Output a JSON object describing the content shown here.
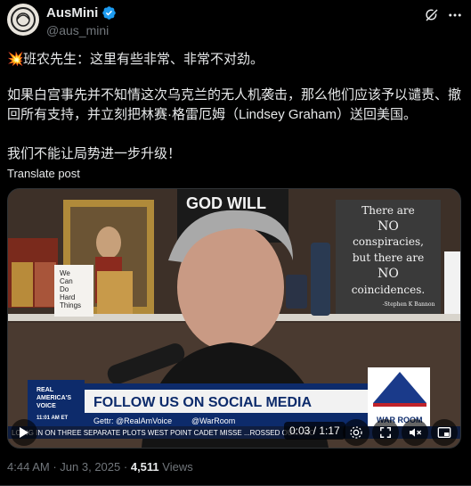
{
  "account": {
    "display_name": "AusMini",
    "handle": "@aus_mini"
  },
  "post": {
    "line1_emoji": "💥",
    "line1_text": "班农先生：这里有些非常、非常不对劲。",
    "paragraph2": "如果白宫事先并不知情这次乌克兰的无人机袭击，那么他们应该予以谴责、撤回所有支持，并立刻把林赛·格雷厄姆（Lindsey Graham）送回美国。",
    "paragraph3": "我们不能让局势进一步升级！",
    "translate_label": "Translate post"
  },
  "video": {
    "wall_sign": "GOD WILL",
    "sign_lines": [
      "There are",
      "NO",
      "conspiracies,",
      "but there are",
      "NO",
      "coincidences."
    ],
    "sign_credit": "-Stephen K Bannon",
    "small_sign": [
      "We",
      "Can",
      "Do",
      "Hard",
      "Things"
    ],
    "lower_third_title": "FOLLOW US ON SOCIAL MEDIA",
    "network_logo_line1": "REAL",
    "network_logo_line2": "AMERICA'S",
    "network_logo_line3": "VOICE",
    "clock": "11:01 AM ET",
    "gettr": "Gettr: @RealAmVoice",
    "warroom_handle": "@WarRoom",
    "warroom_logo": "WAR ROOM",
    "ticker": "LOING IN ON THREE SEPARATE PLOTS     WEST POINT CADET MISSE     ...ROSSED OUT... RO",
    "time_display": "0:03 / 1:17"
  },
  "meta": {
    "time": "4:44 AM",
    "separator": "·",
    "date": "Jun 3, 2025",
    "views_count": "4,511",
    "views_label": "Views"
  },
  "colors": {
    "background": "#000000",
    "text": "#e7e9ea",
    "muted": "#71767b",
    "verified": "#1d9bf0"
  }
}
